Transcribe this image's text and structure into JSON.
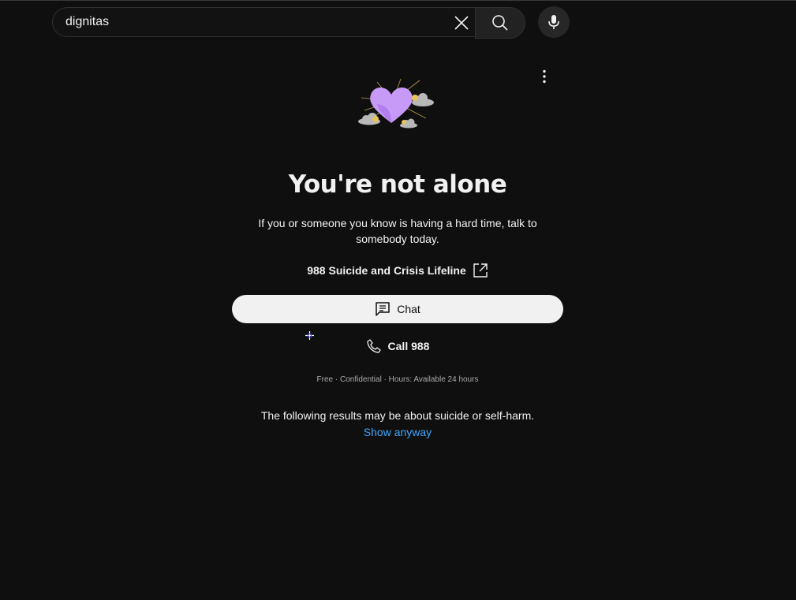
{
  "search": {
    "value": "dignitas",
    "clear_icon": "close-icon",
    "search_icon": "search-icon",
    "mic_icon": "microphone-icon"
  },
  "menu": {
    "icon": "more-vert-icon"
  },
  "crisis_panel": {
    "illustration": "heart-with-clouds",
    "title": "You're not alone",
    "subtitle": "If you or someone you know is having a hard time, talk to somebody today.",
    "lifeline_label": "988 Suicide and Crisis Lifeline",
    "lifeline_icon": "open-external-icon",
    "chat_label": "Chat",
    "chat_icon": "chat-icon",
    "call_label": "Call 988",
    "call_icon": "phone-icon",
    "fineprint": "Free · Confidential · Hours: Available 24 hours"
  },
  "results_notice": {
    "text": "The following results may be about suicide or self-harm.",
    "link_label": "Show anyway"
  },
  "colors": {
    "background": "#0f0f0f",
    "text": "#f1f1f1",
    "link": "#3ea6ff",
    "button_bg": "#f1f1f1",
    "heart": "#c89af7"
  }
}
